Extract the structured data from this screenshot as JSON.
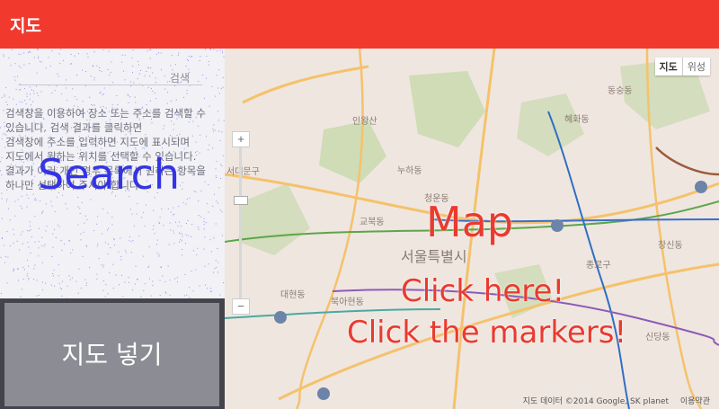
{
  "appbar": {
    "title": "지도"
  },
  "sidebar": {
    "search_placeholder": "검색",
    "help_lines": [
      "검색창을 이용하여 장소 또는 주소를 검색할 수",
      "있습니다. 검색 결과를 클릭하면",
      "검색창에 주소를 입력하면 지도에 표시되며",
      "지도에서 원하는 위치를 선택할 수 있습니다.",
      "결과가 여러 개인 경우 목록에서 원하는 항목을",
      "하나만 선택하여 주셔야 합니다."
    ],
    "search_label": "Search",
    "insert_button": "지도 넣기"
  },
  "map": {
    "type_control": {
      "map": "지도",
      "satellite": "위성"
    },
    "zoom_in": "+",
    "zoom_out": "−",
    "overlay_map": "Map",
    "overlay_click_here": "Click here!",
    "overlay_click_markers": "Click the markers!",
    "place_labels": [
      "인왕산",
      "서대문구",
      "누하동",
      "청운동",
      "교북동",
      "서울특별시",
      "종로구",
      "동숭동",
      "혜화동",
      "창신동",
      "대현동",
      "북아현동",
      "신당동"
    ],
    "attribution": "지도 데이터 ©2014 Google, SK planet",
    "terms": "이용약관"
  },
  "colors": {
    "appbar": "#f2392e",
    "search_label": "#3434e6",
    "overlay_text": "#ea3a2f",
    "insert_button": "#8c8c94"
  }
}
